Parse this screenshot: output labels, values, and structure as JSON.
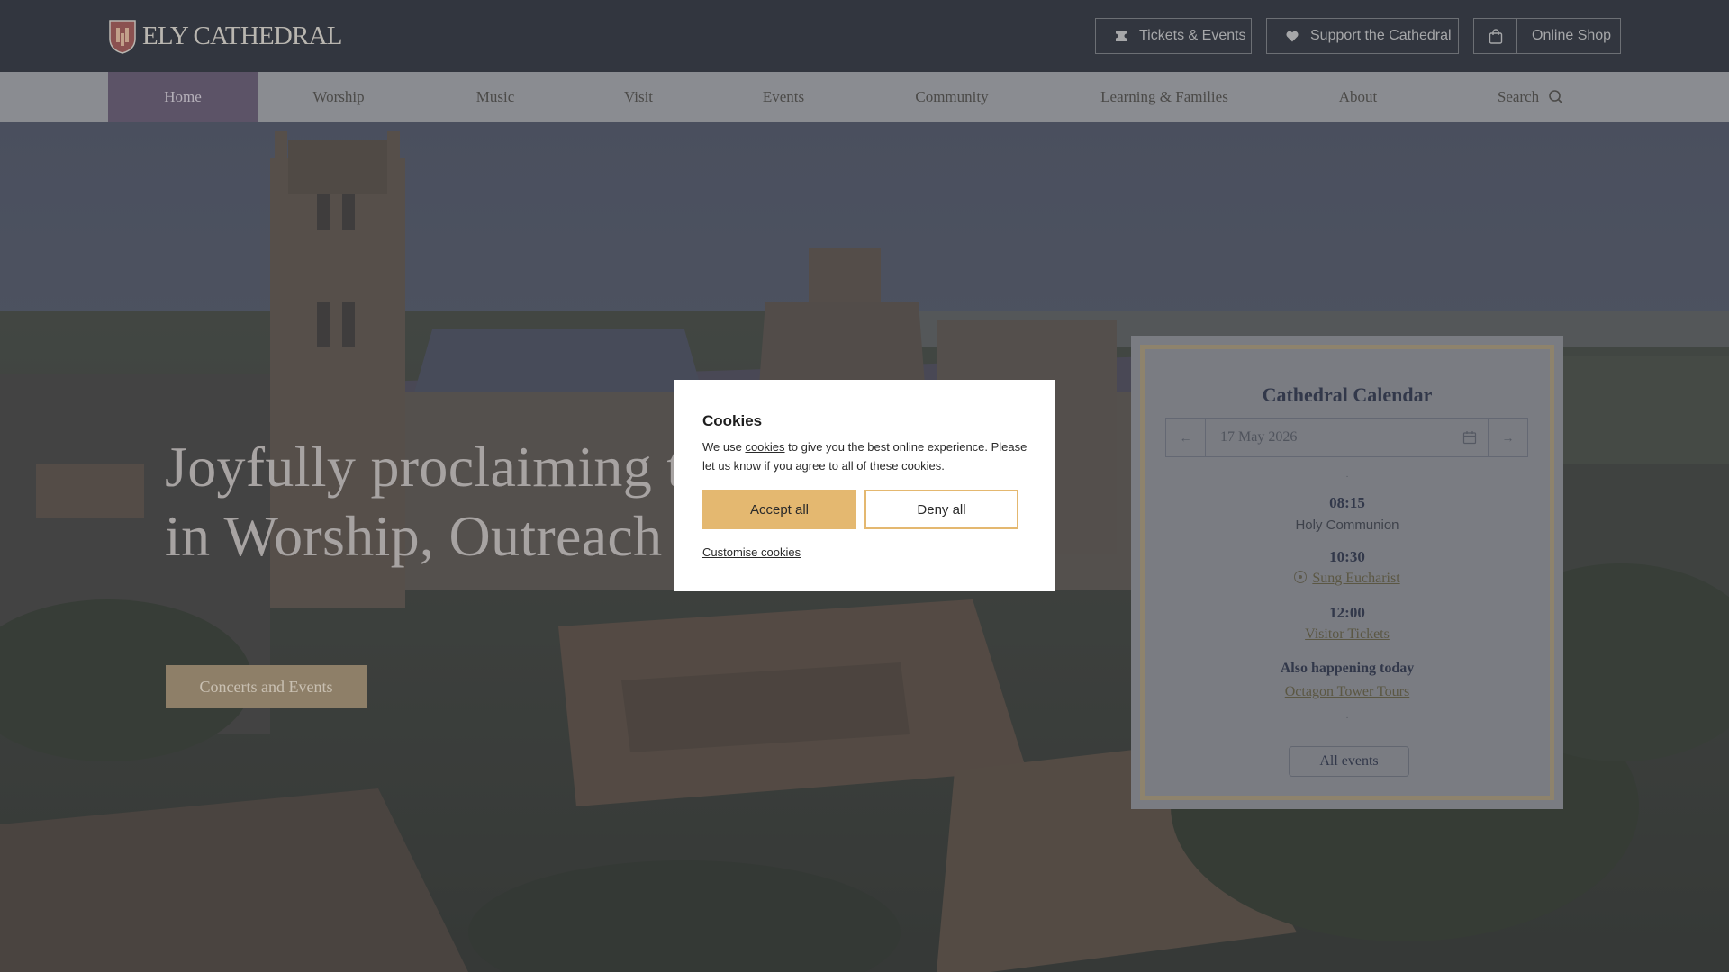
{
  "header": {
    "logo_text": "ELY CATHEDRAL",
    "tickets_label": "Tickets & Events",
    "support_label": "Support the Cathedral",
    "shop_label": "Online Shop"
  },
  "nav": {
    "items": [
      {
        "label": "Home",
        "active": true
      },
      {
        "label": "Worship"
      },
      {
        "label": "Music"
      },
      {
        "label": "Visit"
      },
      {
        "label": "Events"
      },
      {
        "label": "Community"
      },
      {
        "label": "Learning & Families"
      },
      {
        "label": "About"
      }
    ],
    "search_label": "Search"
  },
  "hero": {
    "title": "Joyfully proclaiming the Gospel in Worship, Outreach and Care",
    "cta_label": "Concerts and Events"
  },
  "calendar": {
    "title": "Cathedral Calendar",
    "date": "17 May 2026",
    "events": [
      {
        "time": "08:15",
        "name": "Holy Communion"
      },
      {
        "time": "10:30",
        "name": "Sung Eucharist",
        "link": true,
        "live": true
      },
      {
        "time": "12:00",
        "name": "Visitor Tickets",
        "link": true
      }
    ],
    "also_heading": "Also happening today",
    "also_event": "Octagon Tower Tours",
    "all_events_label": "All events"
  },
  "cookie_modal": {
    "title": "Cookies",
    "text_prefix": "We use ",
    "text_link": "cookies",
    "text_suffix": " to give you the best online experience. Please let us know if you agree to all of these cookies.",
    "accept_label": "Accept all",
    "deny_label": "Deny all",
    "customise_label": "Customise cookies"
  },
  "colors": {
    "overlay_header": "#32363f",
    "nav_active": "#5c5367",
    "accent_gold": "#e4b870",
    "modal_bg": "#ffffff"
  },
  "icons": {
    "tickets": "ticket-icon",
    "support": "heart-icon",
    "shop": "shopping-bag-icon",
    "search": "search-icon",
    "calendar": "calendar-icon",
    "prev": "arrow-left-icon",
    "next": "arrow-right-icon"
  }
}
